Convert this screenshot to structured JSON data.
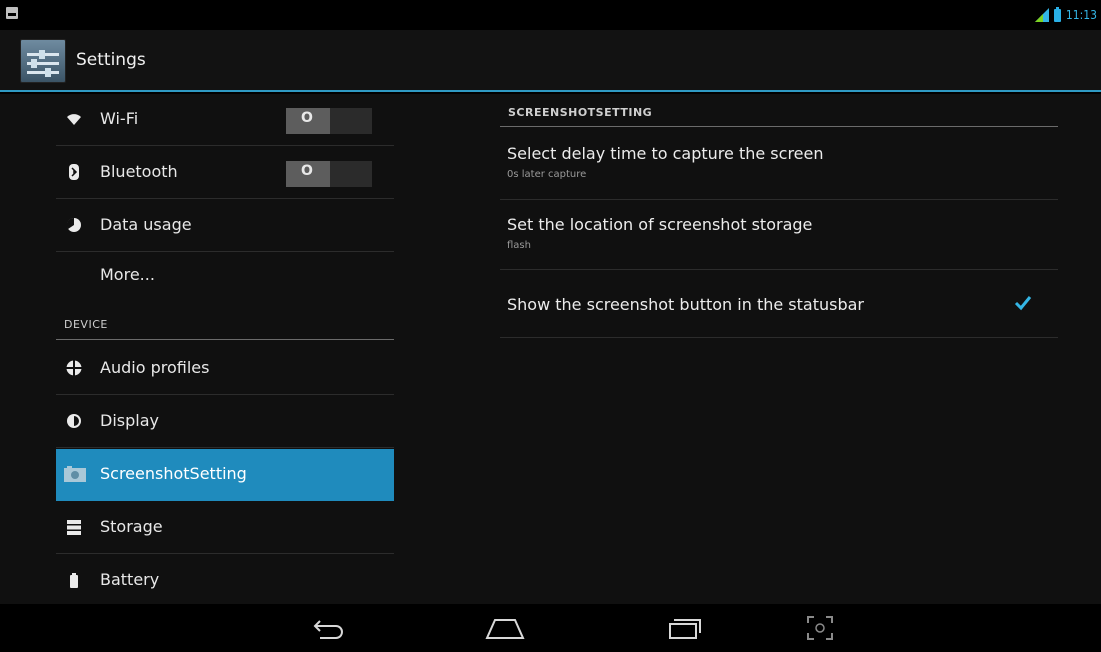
{
  "status_bar": {
    "time": "11:13",
    "accent_color": "#34b5e5"
  },
  "action_bar": {
    "title": "Settings",
    "icon": "settings-app-icon"
  },
  "left_menu": {
    "wireless_items": [
      {
        "label": "Wi-Fi",
        "icon": "wifi-icon",
        "toggle": "O"
      },
      {
        "label": "Bluetooth",
        "icon": "bluetooth-icon",
        "toggle": "O"
      },
      {
        "label": "Data usage",
        "icon": "data-usage-icon"
      },
      {
        "label": "More..."
      }
    ],
    "device_header": "DEVICE",
    "device_items": [
      {
        "label": "Audio profiles",
        "icon": "audio-profiles-icon"
      },
      {
        "label": "Display",
        "icon": "display-icon"
      },
      {
        "label": "ScreenshotSetting",
        "icon": "camera-icon",
        "selected": true
      },
      {
        "label": "Storage",
        "icon": "storage-icon"
      },
      {
        "label": "Battery",
        "icon": "battery-icon"
      }
    ],
    "selected_color": "#1f8bbd"
  },
  "detail": {
    "header": "SCREENSHOTSETTING",
    "prefs": [
      {
        "title": "Select delay time to capture the screen",
        "summary": "0s later capture"
      },
      {
        "title": "Set the location of screenshot storage",
        "summary": "flash"
      },
      {
        "title": "Show the screenshot button in the statusbar",
        "checked": true
      }
    ]
  },
  "nav_bar": {
    "buttons": [
      "back-icon",
      "home-icon",
      "recents-icon",
      "screenshot-icon"
    ]
  }
}
